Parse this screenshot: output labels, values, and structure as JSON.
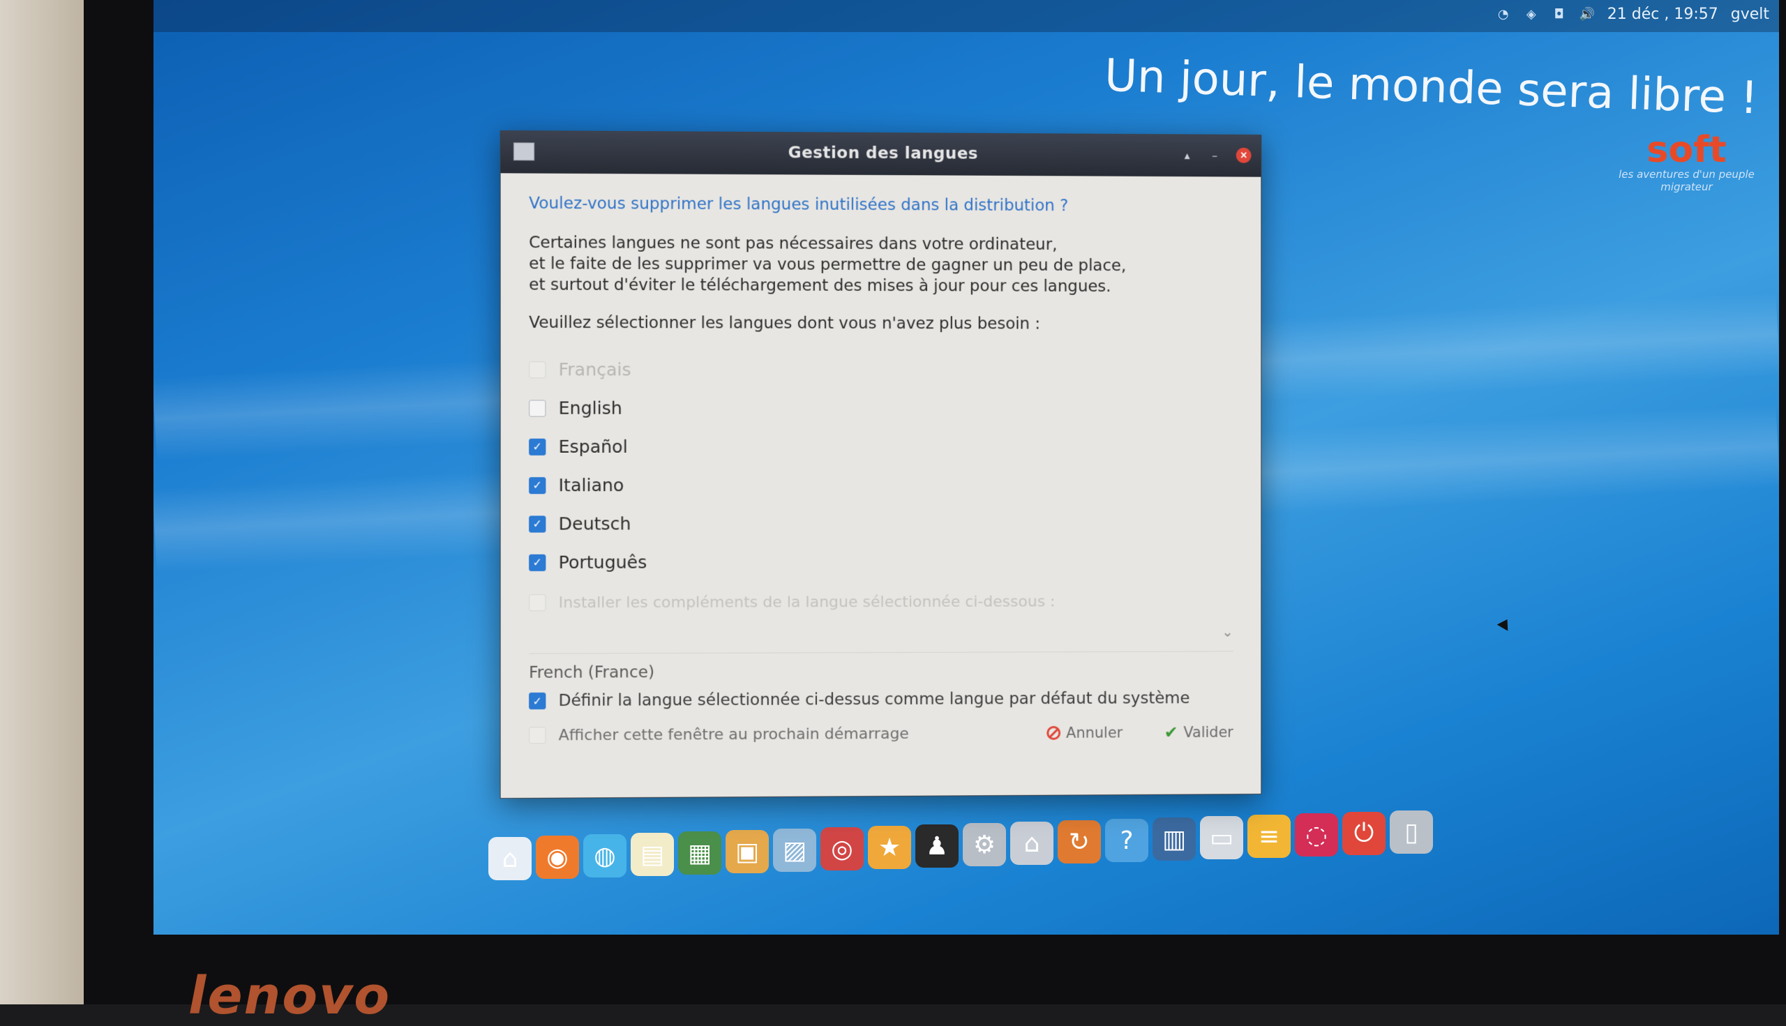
{
  "top_panel": {
    "datetime": "21 déc , 19:57",
    "user": "gvelt"
  },
  "wallpaper": {
    "slogan": "Un jour, le monde sera libre !",
    "brand_name": "soft",
    "brand_tagline": "les aventures d'un peuple migrateur"
  },
  "dialog": {
    "title": "Gestion des langues",
    "question": "Voulez-vous supprimer les langues inutilisées dans la distribution ?",
    "description_lines": [
      "Certaines langues ne sont pas nécessaires dans votre ordinateur,",
      "et le faite de les supprimer va vous permettre de gagner un peu de place,",
      "et surtout d'éviter le téléchargement des mises à jour pour ces langues."
    ],
    "prompt": "Veuillez sélectionner les langues dont vous n'avez plus besoin :",
    "languages": [
      {
        "label": "Français",
        "checked": false,
        "disabled": true
      },
      {
        "label": "English",
        "checked": false,
        "disabled": false
      },
      {
        "label": "Español",
        "checked": true,
        "disabled": false
      },
      {
        "label": "Italiano",
        "checked": true,
        "disabled": false
      },
      {
        "label": "Deutsch",
        "checked": true,
        "disabled": false
      },
      {
        "label": "Português",
        "checked": true,
        "disabled": false
      }
    ],
    "addons_label": "Installer les compléments de la langue sélectionnée ci-dessous :",
    "locale_value": "French (France)",
    "default_label": "Définir la langue sélectionnée ci-dessus comme langue par défaut du système",
    "startup_label": "Afficher cette fenêtre au prochain démarrage",
    "cancel_label": "Annuler",
    "ok_label": "Valider"
  },
  "dock_items": [
    {
      "name": "home-icon",
      "color": "#e8eef5"
    },
    {
      "name": "firefox-icon",
      "color": "#f07a2c"
    },
    {
      "name": "network-globe-icon",
      "color": "#46b4e8"
    },
    {
      "name": "notes-icon",
      "color": "#f3ecc9"
    },
    {
      "name": "spreadsheet-icon",
      "color": "#4a8f4a"
    },
    {
      "name": "video-editor-icon",
      "color": "#e5a84b"
    },
    {
      "name": "image-viewer-icon",
      "color": "#8fb7d8"
    },
    {
      "name": "media-player-icon",
      "color": "#d24545"
    },
    {
      "name": "favorites-star-icon",
      "color": "#f0a83a"
    },
    {
      "name": "linux-tux-icon",
      "color": "#2a2a2a"
    },
    {
      "name": "settings-gear-icon",
      "color": "#b8bec6"
    },
    {
      "name": "home-folder-icon",
      "color": "#c9ced6"
    },
    {
      "name": "update-icon",
      "color": "#e07a30"
    },
    {
      "name": "help-icon",
      "color": "#4fa3e0"
    },
    {
      "name": "workspace-switcher-icon",
      "color": "#3b6aa0"
    },
    {
      "name": "window-list-icon",
      "color": "#d6dbe2"
    },
    {
      "name": "notes-yellow-icon",
      "color": "#f2b634"
    },
    {
      "name": "debian-swirl-icon",
      "color": "#d42d56"
    },
    {
      "name": "power-icon",
      "color": "#e0473a"
    },
    {
      "name": "trash-icon",
      "color": "#b9c0c8"
    }
  ]
}
